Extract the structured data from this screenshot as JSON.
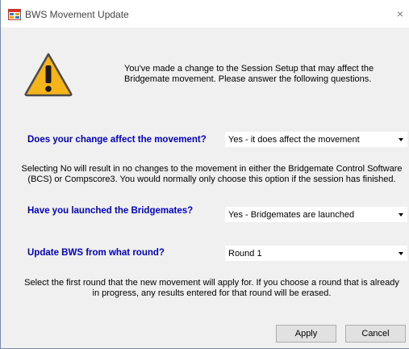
{
  "window": {
    "title": "BWS Movement Update",
    "close_glyph": "×"
  },
  "intro": {
    "text": "You've made a change to the Session Setup that may affect the Bridgemate movement. Please answer the following questions."
  },
  "questions": {
    "affect": {
      "label": "Does your change affect the movement?",
      "value": "Yes - it does affect the movement"
    },
    "launched": {
      "label": "Have you launched the Bridgemates?",
      "value": "Yes - Bridgemates are launched"
    },
    "round": {
      "label": "Update BWS from what round?",
      "value": "Round 1"
    }
  },
  "notes": {
    "selecting_no": "Selecting No will result in no changes to the movement in either the Bridgemate Control Software (BCS) or Compscore3. You would normally only choose this option  if the session has finished.",
    "round_help": "Select the first round that the new movement will apply for. If you choose a round that is already in progress, any results entered for that round will be erased."
  },
  "buttons": {
    "apply": "Apply",
    "cancel": "Cancel"
  },
  "icons": {
    "app": "window-app-icon",
    "warning": "warning-triangle-icon"
  },
  "colors": {
    "question_text": "#0000cc",
    "warning_fill": "#f5b51a"
  }
}
